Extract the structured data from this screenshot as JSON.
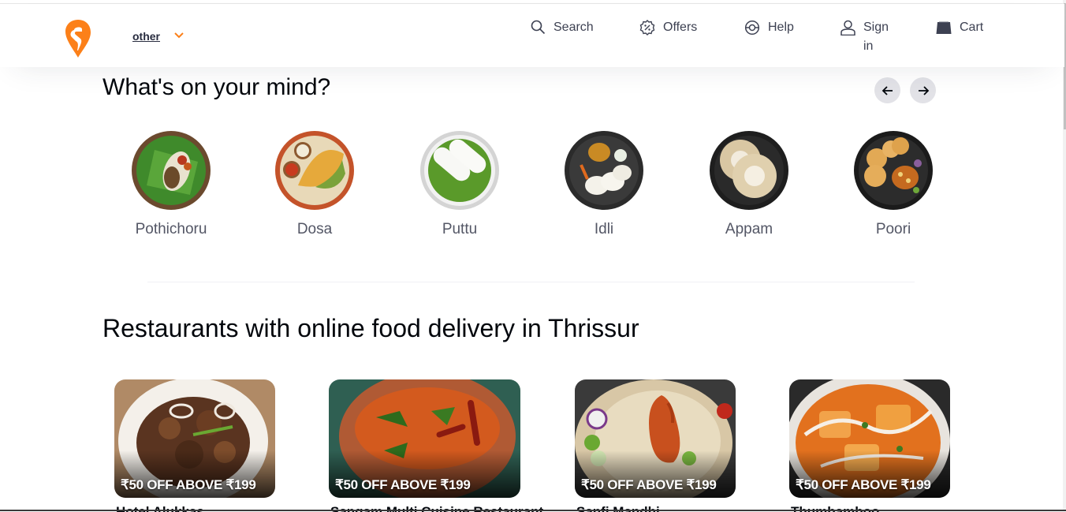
{
  "header": {
    "location": "other",
    "nav": {
      "search": "Search",
      "offers": "Offers",
      "help": "Help",
      "signin": "Sign in",
      "cart": "Cart"
    },
    "brand_color": "#fc8019"
  },
  "mind": {
    "title": "What's on your mind?",
    "items": [
      {
        "name": "Pothichoru",
        "icon": "pothichoru-plate"
      },
      {
        "name": "Dosa",
        "icon": "dosa-plate"
      },
      {
        "name": "Puttu",
        "icon": "puttu-plate"
      },
      {
        "name": "Idli",
        "icon": "idli-plate"
      },
      {
        "name": "Appam",
        "icon": "appam-plate"
      },
      {
        "name": "Poori",
        "icon": "poori-plate"
      }
    ]
  },
  "restaurants": {
    "title": "Restaurants with online food delivery in Thrissur",
    "cards": [
      {
        "offer": "₹50 OFF ABOVE ₹199",
        "name": "Hotel Alukkas"
      },
      {
        "offer": "₹50 OFF ABOVE ₹199",
        "name": "Sangam Multi Cuisine Restaurant"
      },
      {
        "offer": "₹50 OFF ABOVE ₹199",
        "name": "Sanfi Mandhi"
      },
      {
        "offer": "₹50 OFF ABOVE ₹199",
        "name": "Thumbamboo"
      }
    ]
  }
}
